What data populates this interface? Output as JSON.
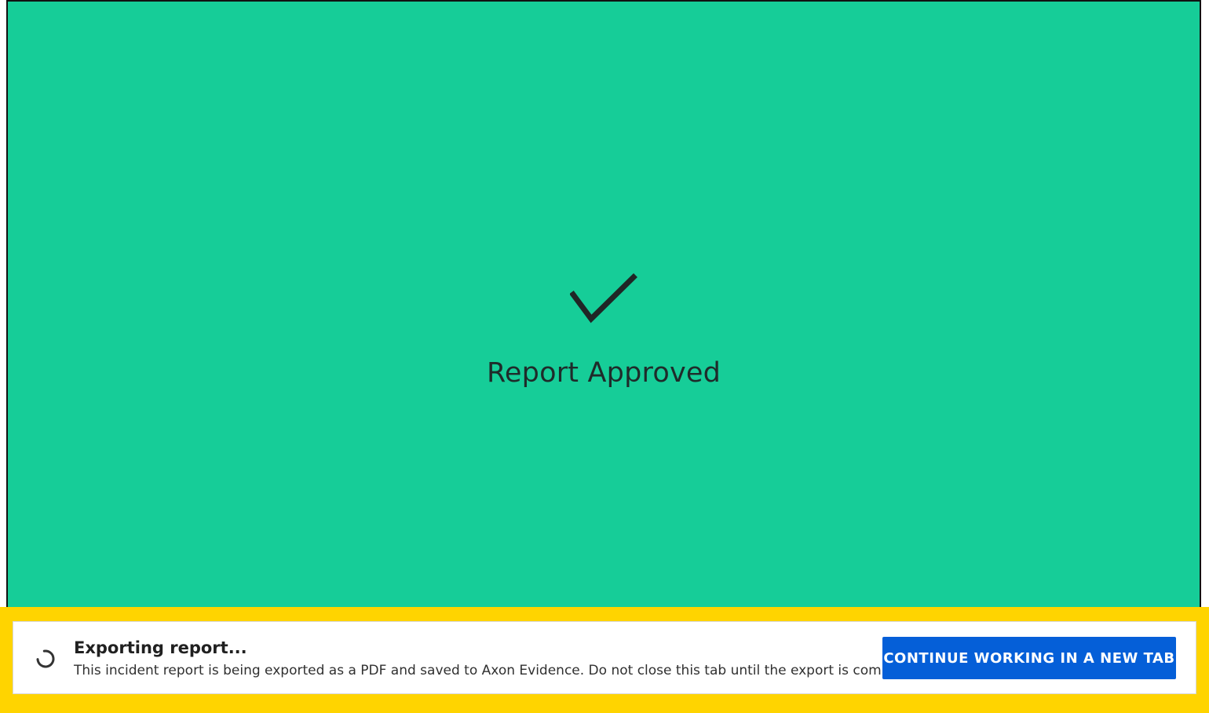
{
  "approval": {
    "icon": "checkmark-icon",
    "title": "Report Approved",
    "background_color": "#16cd98"
  },
  "export_banner": {
    "icon": "loading-spinner-icon",
    "title": "Exporting report...",
    "message": "This incident report is being exported as a PDF and saved to Axon Evidence. Do not close this tab until the export is complete.",
    "button_label": "CONTINUE WORKING IN A NEW TAB",
    "button_color": "#055fd8",
    "highlight_color": "#ffd400"
  }
}
